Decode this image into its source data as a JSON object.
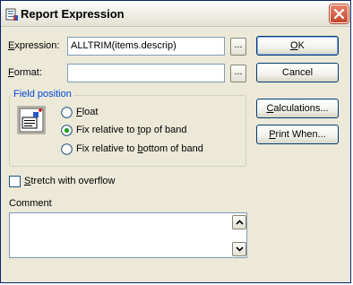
{
  "window": {
    "title": "Report Expression"
  },
  "fields": {
    "expression_label_key": "E",
    "expression_label_rest": "xpression:",
    "expression_value": "ALLTRIM(items.descrip)",
    "expression_builder": "...",
    "format_label_key": "F",
    "format_label_rest": "ormat:",
    "format_value": "",
    "format_builder": "..."
  },
  "buttons": {
    "ok_key": "O",
    "ok_rest": "K",
    "cancel": "Cancel",
    "calculations_key": "C",
    "calculations_rest": "alculations...",
    "printwhen_key": "P",
    "printwhen_rest": "rint When..."
  },
  "field_position": {
    "title": "Field position",
    "options": [
      {
        "key": "F",
        "pre": "",
        "post": "loat",
        "selected": false
      },
      {
        "pre": "Fix relative to ",
        "key": "t",
        "post": "op of band",
        "selected": true
      },
      {
        "pre": "Fix relative to ",
        "key": "b",
        "post": "ottom of band",
        "selected": false
      }
    ]
  },
  "stretch": {
    "key": "S",
    "rest": "tretch with overflow",
    "checked": false
  },
  "comment": {
    "label": "Comment",
    "value": ""
  },
  "icons": {
    "app": "report-app-icon",
    "close": "close-icon",
    "band": "field-position-band-icon",
    "scroll_up": "chevron-up-icon",
    "scroll_down": "chevron-down-icon"
  }
}
